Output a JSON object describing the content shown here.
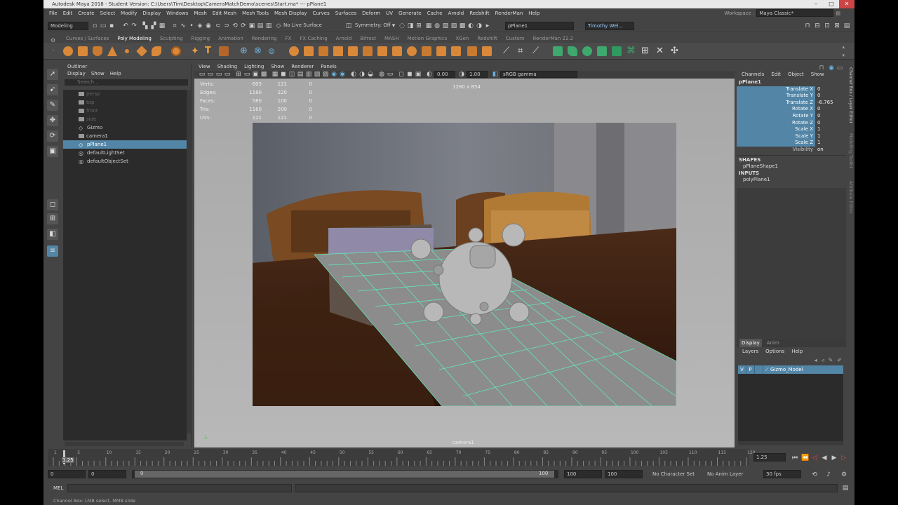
{
  "window": {
    "title": "Autodesk Maya 2018 - Student Version: C:\\Users\\Tim\\Desktop\\CameraMatchDemo\\scenes\\Start.ma* --- pPlane1"
  },
  "menubar": {
    "items": [
      "File",
      "Edit",
      "Create",
      "Select",
      "Modify",
      "Display",
      "Windows",
      "Mesh",
      "Edit Mesh",
      "Mesh Tools",
      "Mesh Display",
      "Curves",
      "Surfaces",
      "Deform",
      "UV",
      "Generate",
      "Cache",
      "Arnold",
      "Redshift",
      "RenderMan",
      "Help"
    ],
    "workspace_label": "Workspace :",
    "workspace_value": "Maya Classic*"
  },
  "statusline": {
    "mode": "Modeling",
    "live_surface": "No Live Surface",
    "symmetry": "Symmetry: Off",
    "object_name": "pPlane1",
    "user": "Timothy Wel..."
  },
  "shelf_tabs": [
    "Curves / Surfaces",
    "Poly Modeling",
    "Sculpting",
    "Rigging",
    "Animation",
    "Rendering",
    "FX",
    "FX Caching",
    "Arnold",
    "Bifrost",
    "MASH",
    "Motion Graphics",
    "XGen",
    "Redshift",
    "Custom",
    "RenderMan 22.2"
  ],
  "shelf_active": "Poly Modeling",
  "outliner": {
    "title": "Outliner",
    "menu": [
      "Display",
      "Show",
      "Help"
    ],
    "search_placeholder": "Search...",
    "items": [
      {
        "label": "persp",
        "state": "dim"
      },
      {
        "label": "top",
        "state": "dim"
      },
      {
        "label": "front",
        "state": "dim"
      },
      {
        "label": "side",
        "state": "dim"
      },
      {
        "label": "Gizmo",
        "state": "normal"
      },
      {
        "label": "camera1",
        "state": "normal"
      },
      {
        "label": "pPlane1",
        "state": "selected"
      },
      {
        "label": "defaultLightSet",
        "state": "normal"
      },
      {
        "label": "defaultObjectSet",
        "state": "normal"
      }
    ]
  },
  "viewport": {
    "menu": [
      "View",
      "Shading",
      "Lighting",
      "Show",
      "Renderer",
      "Panels"
    ],
    "exposure": "0.00",
    "gamma": "1.00",
    "color_space": "sRGB gamma",
    "resolution": "1280 x 854",
    "camera": "camera1",
    "hud": [
      {
        "label": "Verts:",
        "a": "603",
        "b": "121",
        "c": "0"
      },
      {
        "label": "Edges:",
        "a": "1180",
        "b": "220",
        "c": "0"
      },
      {
        "label": "Faces:",
        "a": "580",
        "b": "100",
        "c": "0"
      },
      {
        "label": "Tris:",
        "a": "1160",
        "b": "200",
        "c": "0"
      },
      {
        "label": "UVs:",
        "a": "121",
        "b": "121",
        "c": "0"
      }
    ]
  },
  "channelbox": {
    "menu": [
      "Channels",
      "Edit",
      "Object",
      "Show"
    ],
    "object": "pPlane1",
    "attributes": [
      {
        "name": "Translate X",
        "value": "0"
      },
      {
        "name": "Translate Y",
        "value": "0"
      },
      {
        "name": "Translate Z",
        "value": "-6.765"
      },
      {
        "name": "Rotate X",
        "value": "0"
      },
      {
        "name": "Rotate Y",
        "value": "0"
      },
      {
        "name": "Rotate Z",
        "value": "0"
      },
      {
        "name": "Scale X",
        "value": "1"
      },
      {
        "name": "Scale Y",
        "value": "1"
      },
      {
        "name": "Scale Z",
        "value": "1"
      },
      {
        "name": "Visibility",
        "value": "on"
      }
    ],
    "shapes_label": "SHAPES",
    "shape": "pPlaneShape1",
    "inputs_label": "INPUTS",
    "input": "polyPlane1"
  },
  "layers": {
    "tabs": [
      "Display",
      "Anim"
    ],
    "menu": [
      "Layers",
      "Options",
      "Help"
    ],
    "layer_v": "V",
    "layer_p": "P",
    "layer_name": "Gizmo_Model"
  },
  "sidetabs": [
    "Channel Box / Layer Editor",
    "Modelling Toolkit",
    "Attribute Editor"
  ],
  "timeline": {
    "ticks": [
      "1",
      "5",
      "10",
      "15",
      "20",
      "25",
      "30",
      "35",
      "40",
      "45",
      "50",
      "55",
      "60",
      "65",
      "70",
      "75",
      "80",
      "85",
      "90",
      "95",
      "100",
      "105",
      "110",
      "115",
      "120"
    ],
    "current_frame_label": "1.25",
    "current_frame_field": "1.25"
  },
  "range": {
    "start": "0",
    "anim_start": "0",
    "slider_start": "0",
    "slider_end": "100",
    "end": "100",
    "anim_end": "100",
    "char_set": "No Character Set",
    "anim_layer": "No Anim Layer",
    "fps": "30 fps"
  },
  "cmdline": {
    "lang": "MEL"
  },
  "status": {
    "help": "Channel Box: LMB select, MMB slide"
  }
}
